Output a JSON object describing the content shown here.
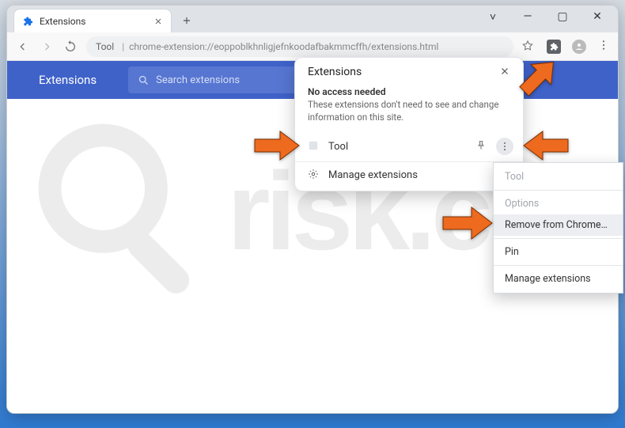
{
  "tab": {
    "title": "Extensions"
  },
  "omnibox": {
    "label": "Tool",
    "url": "chrome-extension://eoppoblkhnligjefnkoodafbakmmcffh/extensions.html"
  },
  "ext_header": {
    "title": "Extensions",
    "search_placeholder": "Search extensions"
  },
  "popup": {
    "title": "Extensions",
    "section_heading": "No access needed",
    "section_desc": "These extensions don't need to see and change information on this site.",
    "items": [
      {
        "label": "Tool"
      }
    ],
    "manage_label": "Manage extensions"
  },
  "context_menu": {
    "items": [
      {
        "label": "Tool",
        "disabled": true
      },
      {
        "label": "Options",
        "disabled": true
      },
      {
        "label": "Remove from Chrome…",
        "highlighted": true
      },
      {
        "label": "Pin"
      },
      {
        "label": "Manage extensions"
      }
    ]
  },
  "colors": {
    "header": "#3f62c9",
    "arrow": "#ed6a1f"
  }
}
